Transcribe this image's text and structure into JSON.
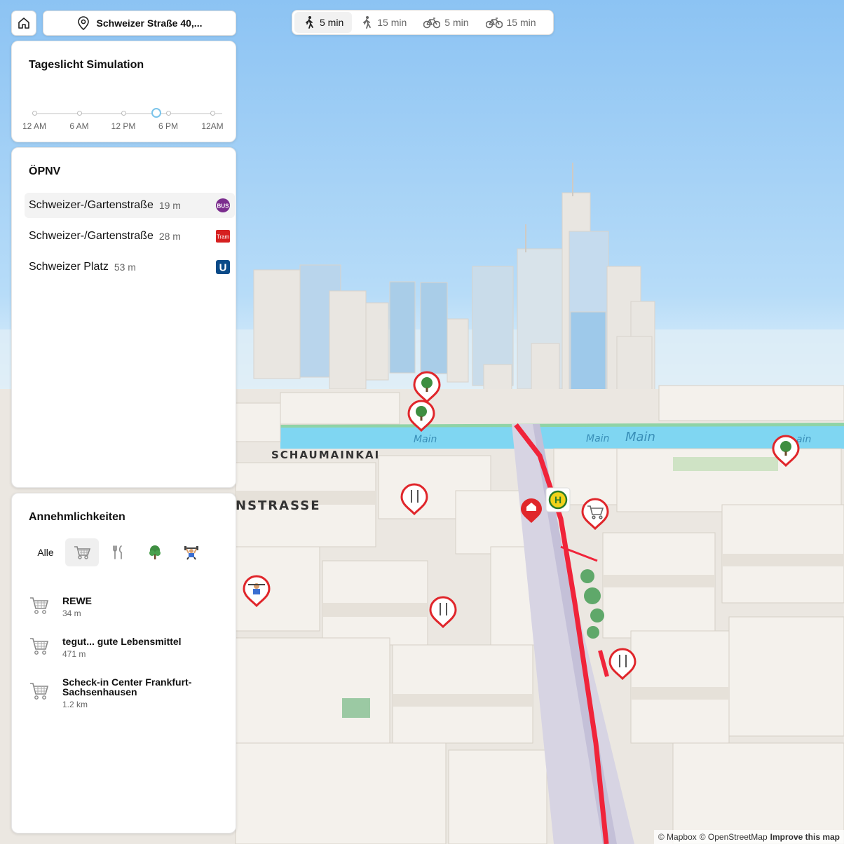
{
  "header": {
    "address": "Schweizer Straße 40,..."
  },
  "modes": [
    {
      "label": "5 min",
      "icon": "walk-icon",
      "active": true
    },
    {
      "label": "15 min",
      "icon": "walk-icon",
      "active": false
    },
    {
      "label": "5 min",
      "icon": "bike-icon",
      "active": false
    },
    {
      "label": "15 min",
      "icon": "bike-icon",
      "active": false
    }
  ],
  "daylight": {
    "title": "Tageslicht Simulation",
    "ticks": [
      "12 AM",
      "6 AM",
      "12 PM",
      "6 PM",
      "12AM"
    ],
    "value_fraction": 0.65
  },
  "transit": {
    "title": "ÖPNV",
    "stops": [
      {
        "name": "Schweizer-/Gartenstraße",
        "distance": "19 m",
        "badge": "BUS",
        "badge_color": "#7b2d8e"
      },
      {
        "name": "Schweizer-/Gartenstraße",
        "distance": "28 m",
        "badge": "Tram",
        "badge_color": "#d62020"
      },
      {
        "name": "Schweizer Platz",
        "distance": "53 m",
        "badge": "U",
        "badge_color": "#0a4a88"
      }
    ]
  },
  "amenities": {
    "title": "Annehmlichkeiten",
    "filter_all": "Alle",
    "filters": [
      "cart-icon",
      "fork-knife-icon",
      "tree-icon",
      "weightlifter-icon"
    ],
    "items": [
      {
        "name": "REWE",
        "distance": "34 m"
      },
      {
        "name": "tegut... gute Lebensmittel",
        "distance": "471 m"
      },
      {
        "name": "Scheck-in Center Frankfurt-Sachsenhausen",
        "distance": "1.2 km"
      }
    ]
  },
  "map": {
    "labels": {
      "schaumainkai": "SCHAUMAINKAI",
      "strasse": "NSTRASSE",
      "main1": "Main",
      "main2": "Main",
      "main3": "Main",
      "main4": "ain"
    },
    "colors": {
      "sky": "#8cc3f3",
      "water": "#7fd6f2",
      "route": "#f0243a",
      "pin": "#e0262b"
    }
  },
  "attribution": {
    "mapbox": "© Mapbox",
    "osm": "© OpenStreetMap",
    "improve": "Improve this map"
  }
}
